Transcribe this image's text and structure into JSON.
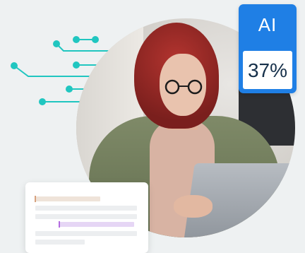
{
  "ai_badge": {
    "label": "AI",
    "score": "37%",
    "color": "#1f7fe5"
  },
  "accent_colors": {
    "circuit": "#20c6c0",
    "highlight_beige": "#efe3d9",
    "highlight_purple": "#e6d6f5"
  },
  "image": {
    "subject": "woman-with-glasses-using-laptop"
  }
}
